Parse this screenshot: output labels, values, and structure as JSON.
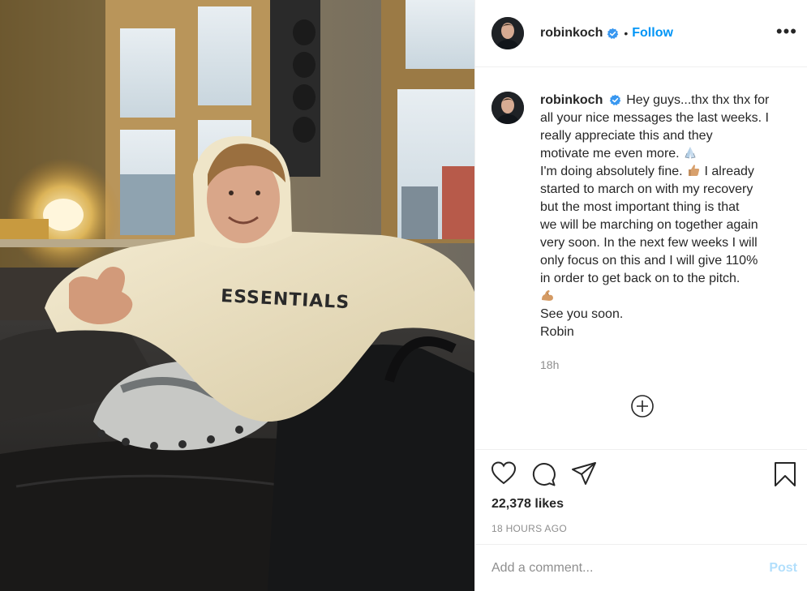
{
  "post": {
    "username": "robinkoch",
    "follow_label": "Follow",
    "separator": "•",
    "more_label": "•••",
    "caption_lines": [
      "Hey guys...thx thx thx for",
      "all your nice messages the last weeks. I",
      "really appreciate this and they",
      "motivate me even more.",
      "I'm doing absolutely fine.",
      "started to march on with my recovery",
      "but the most important thing is that",
      "we will be marching on together again",
      "very soon. In the next few weeks I will",
      "only focus on this and I will give 110%",
      "in order to get back on to the pitch.",
      "",
      "See you soon.",
      "Robin"
    ],
    "caption_line5_tail": "I already",
    "caption_time": "18h",
    "likes": "22,378 likes",
    "time_ago": "18 HOURS AGO"
  },
  "comment": {
    "placeholder": "Add a comment...",
    "post_label": "Post"
  },
  "photo": {
    "hoodie_text": "ESSENTIALS"
  },
  "colors": {
    "accent": "#0095f6",
    "post_disabled": "#b2dffc",
    "secondary_text": "#8e8e8e",
    "border": "#efefef"
  },
  "icons": [
    "verified-badge-icon",
    "more-options-icon",
    "heart-icon",
    "comment-icon",
    "share-icon",
    "bookmark-icon",
    "add-circle-icon",
    "folded-hands-emoji",
    "thumbs-up-emoji",
    "flexed-biceps-emoji"
  ]
}
